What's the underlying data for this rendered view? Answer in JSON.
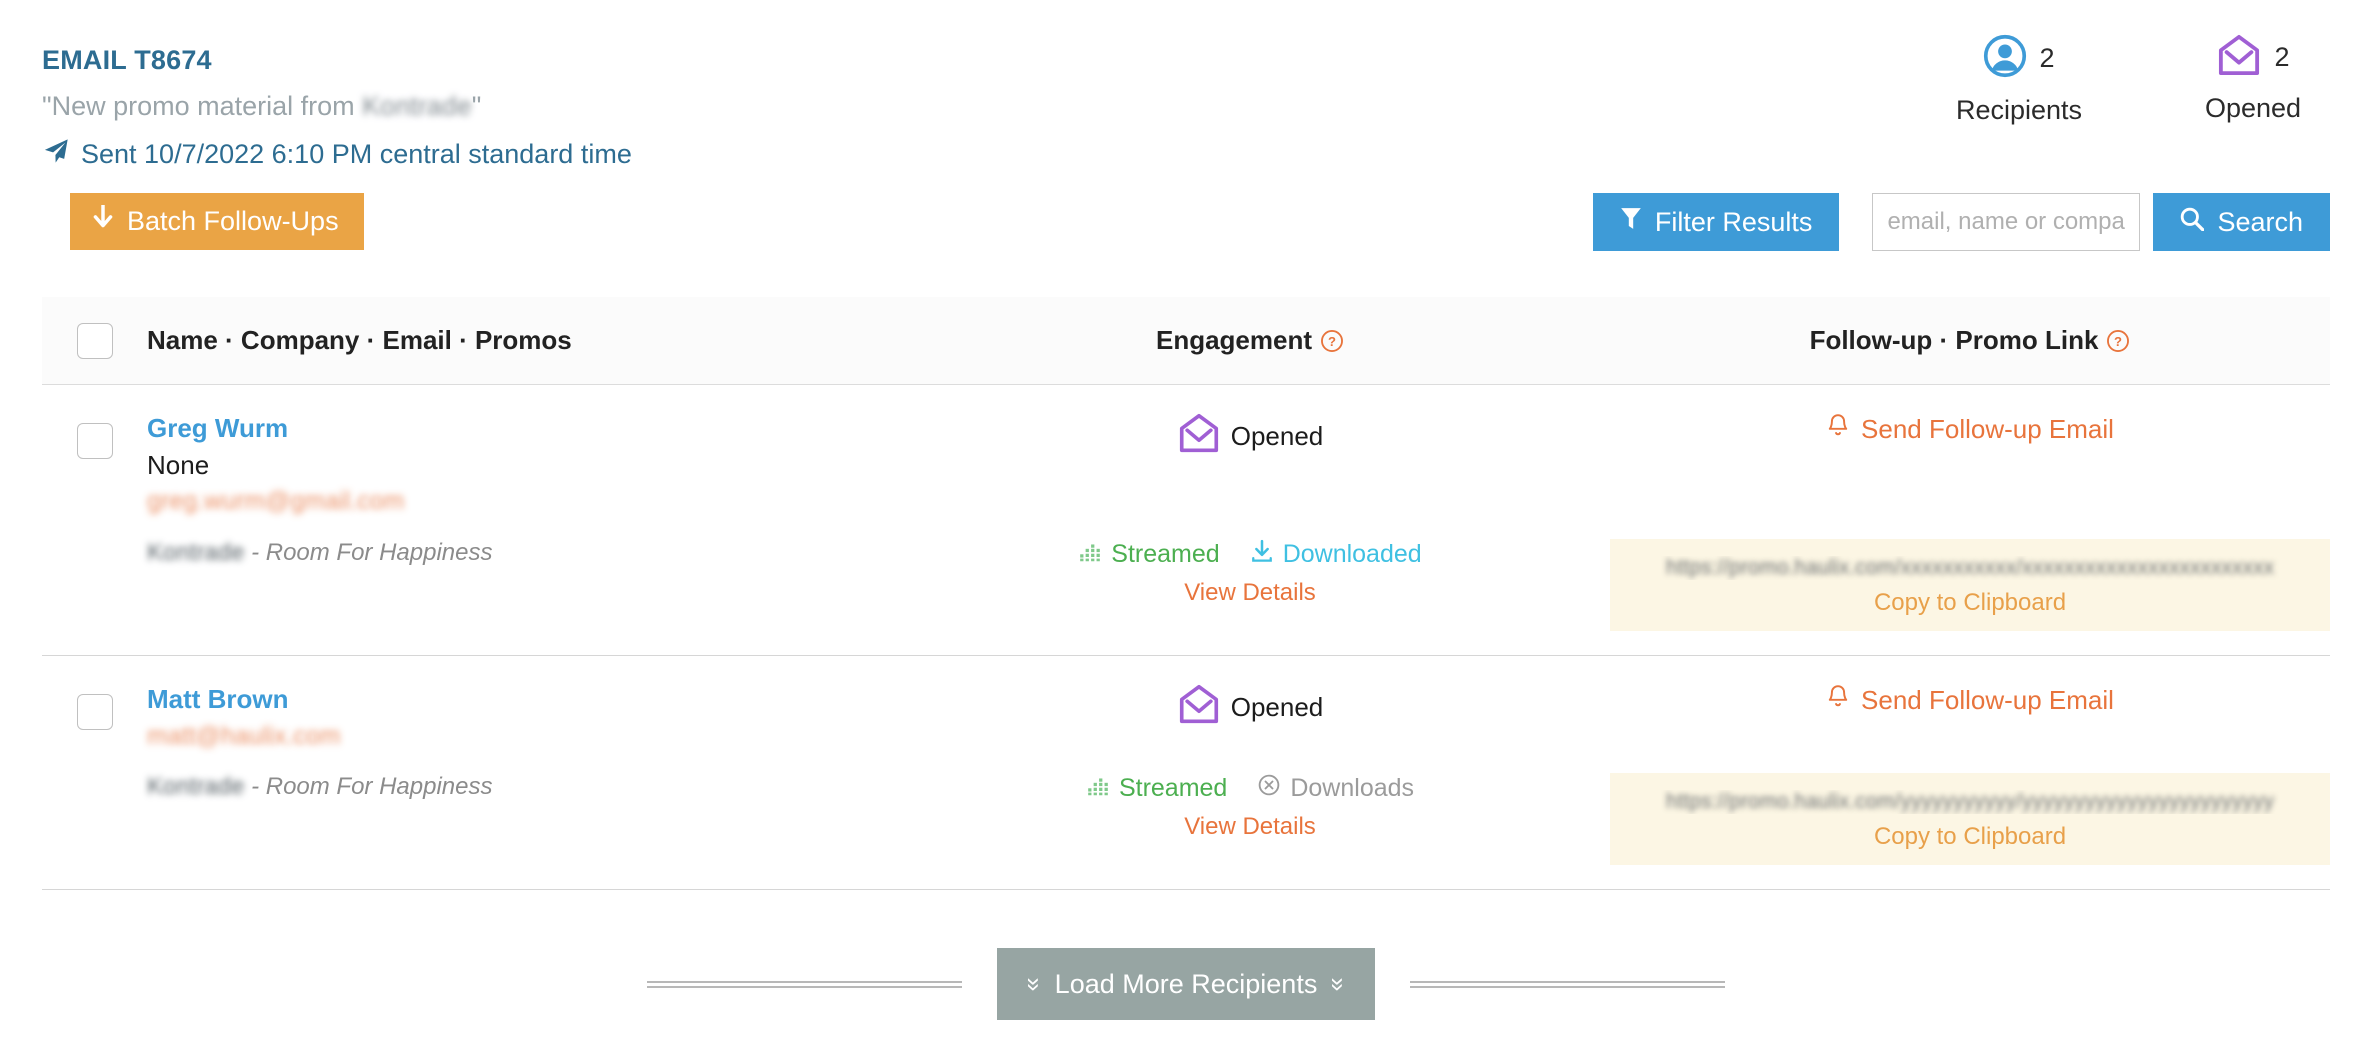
{
  "header": {
    "email_title": "EMAIL T8674",
    "subject_prefix": "\"New promo material from ",
    "subject_redacted": "Kontrade",
    "subject_suffix": "\"",
    "sent_text": "Sent 10/7/2022 6:10 PM central standard time",
    "send_icon": "paper-plane-icon"
  },
  "stats": [
    {
      "icon": "user-circle-icon",
      "value": "2",
      "label": "Recipients",
      "color": "#3e9bd7"
    },
    {
      "icon": "open-envelope-icon",
      "value": "2",
      "label": "Opened",
      "color": "#a05fd4"
    }
  ],
  "toolbar": {
    "batch_label": "Batch Follow-Ups",
    "batch_icon": "arrow-down-icon",
    "batch_color": "#eaa445",
    "filter_label": "Filter Results",
    "filter_icon": "funnel-icon",
    "search_placeholder": "email, name or company",
    "search_value": "",
    "search_label": "Search",
    "search_icon": "magnifier-icon",
    "accent_blue": "#3e9bd7"
  },
  "table": {
    "headers": {
      "name": "Name · Company · Email · Promos",
      "engagement": "Engagement",
      "followup": "Follow-up · Promo Link",
      "help_icon": "question-circle-icon"
    },
    "rows": [
      {
        "name": "Greg Wurm",
        "company": "None",
        "email_redacted": "greg.wurm@gmail.com",
        "promo_artist_redacted": "Kontrade",
        "promo_title": "- Room For Happiness",
        "engagement_status": "Opened",
        "engagement_icon": "open-envelope-icon",
        "streamed_label": "Streamed",
        "streamed_icon": "equalizer-icon",
        "download_label": "Downloaded",
        "download_icon": "download-icon",
        "download_state": "active",
        "view_details_label": "View Details",
        "followup_label": "Send Follow-up Email",
        "followup_icon": "bell-icon",
        "promo_url_redacted": "https://promo.haulix.com/xxxxxxxxxxx/xxxxxxxxxxxxxxxxxxxxxxxx",
        "copy_label": "Copy to Clipboard"
      },
      {
        "name": "Matt Brown",
        "company": "",
        "email_redacted": "matt@haulix.com",
        "promo_artist_redacted": "Kontrade",
        "promo_title": "- Room For Happiness",
        "engagement_status": "Opened",
        "engagement_icon": "open-envelope-icon",
        "streamed_label": "Streamed",
        "streamed_icon": "equalizer-icon",
        "download_label": "Downloads",
        "download_icon": "x-circle-icon",
        "download_state": "disabled",
        "view_details_label": "View Details",
        "followup_label": "Send Follow-up Email",
        "followup_icon": "bell-icon",
        "promo_url_redacted": "https://promo.haulix.com/yyyyyyyyyyy/yyyyyyyyyyyyyyyyyyyyyyyy",
        "copy_label": "Copy to Clipboard"
      }
    ]
  },
  "footer": {
    "load_more_label": "Load More Recipients",
    "chevron_icon": "double-chevron-down-icon"
  }
}
